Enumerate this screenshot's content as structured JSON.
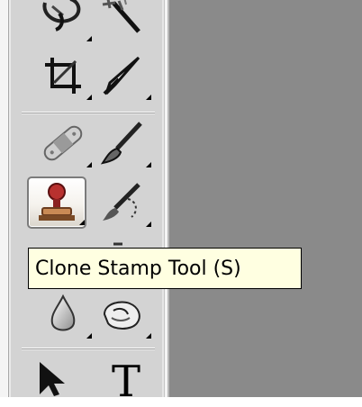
{
  "tooltip": {
    "text": "Clone Stamp Tool (S)"
  },
  "toolbar": {
    "tools": [
      {
        "name": "lasso",
        "icon": "lasso-icon"
      },
      {
        "name": "magic-wand",
        "icon": "magic-wand-icon"
      },
      {
        "name": "crop",
        "icon": "crop-icon"
      },
      {
        "name": "slice",
        "icon": "slice-knife-icon"
      },
      {
        "name": "healing-brush",
        "icon": "bandage-icon"
      },
      {
        "name": "brush",
        "icon": "paintbrush-icon"
      },
      {
        "name": "clone-stamp",
        "icon": "clone-stamp-icon",
        "active": true
      },
      {
        "name": "history-brush",
        "icon": "history-brush-icon"
      },
      {
        "name": "blur",
        "icon": "water-drop-icon"
      },
      {
        "name": "dodge",
        "icon": "hand-pointer-icon"
      },
      {
        "name": "move",
        "icon": "arrow-cursor-icon"
      },
      {
        "name": "type",
        "icon": "text-tool-icon",
        "label": "T"
      }
    ]
  },
  "colors": {
    "toolbar": "#d3d3d3",
    "canvas": "#8a8a8a",
    "tooltip_bg": "#ffffe1"
  }
}
